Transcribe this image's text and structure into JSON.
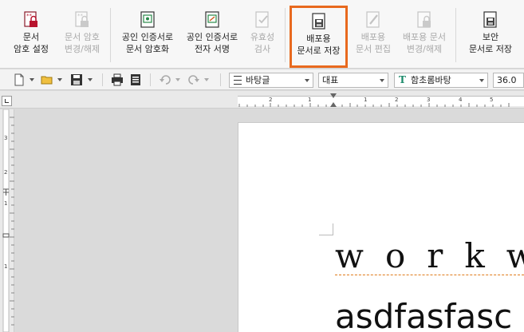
{
  "ribbon": {
    "buttons": [
      {
        "label": "문서\n암호 설정",
        "icon": "lock-document-icon",
        "enabled": true
      },
      {
        "label": "문서 암호\n변경/해제",
        "icon": "lock-document-change-icon",
        "enabled": false
      },
      {
        "label": "공인 인증서로\n문서 암호화",
        "icon": "certificate-encrypt-icon",
        "enabled": true
      },
      {
        "label": "공인 인증서로\n전자 서명",
        "icon": "certificate-sign-icon",
        "enabled": true
      },
      {
        "label": "유효성\n검사",
        "icon": "validity-check-icon",
        "enabled": false
      },
      {
        "label": "배포용\n문서로 저장",
        "icon": "save-distribution-icon",
        "enabled": true,
        "highlighted": true
      },
      {
        "label": "배포용\n문서 편집",
        "icon": "edit-distribution-icon",
        "enabled": false
      },
      {
        "label": "배포용 문서\n변경/해제",
        "icon": "distribution-change-icon",
        "enabled": false
      },
      {
        "label": "보안\n문서로 저장",
        "icon": "secure-save-icon",
        "enabled": true
      }
    ]
  },
  "toolbar": {
    "style_value": "바탕글",
    "language_value": "대표",
    "font_value": "함초롬바탕",
    "size_value": "36.0",
    "highlight_color": "#e8691e"
  },
  "rulers": {
    "h_numbers": [
      "2",
      "1",
      "1",
      "2",
      "3",
      "4",
      "5"
    ],
    "v_numbers": [
      "3",
      "2",
      "1",
      "1"
    ]
  },
  "document": {
    "line1": "workw",
    "line2": "asdfasfasc"
  }
}
